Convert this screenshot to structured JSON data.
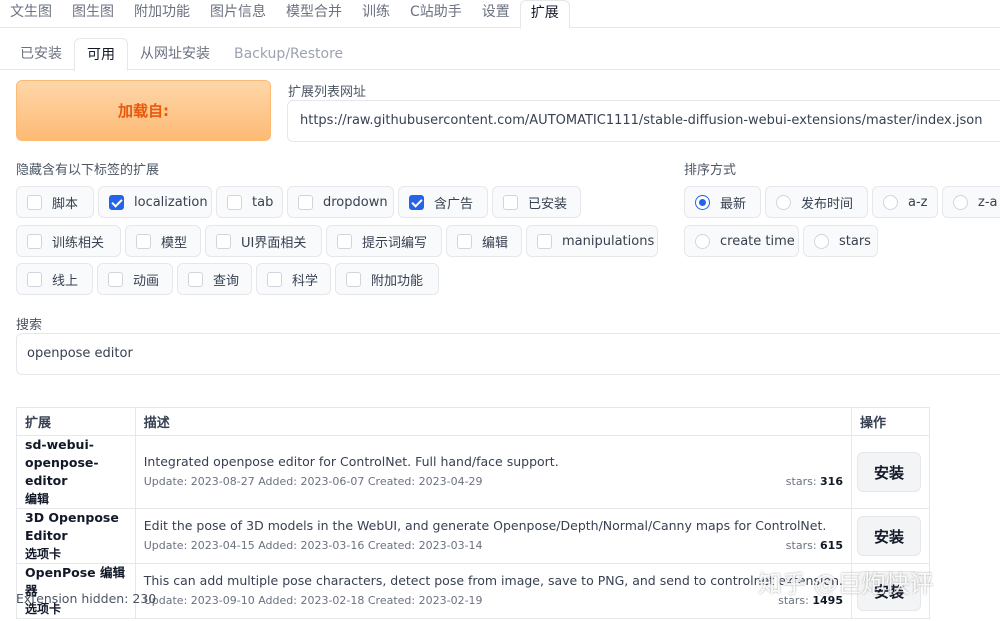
{
  "top_tabs": [
    "文生图",
    "图生图",
    "附加功能",
    "图片信息",
    "模型合并",
    "训练",
    "C站助手",
    "设置",
    "扩展"
  ],
  "sub_tabs": [
    "已安装",
    "可用",
    "从网址安装",
    "Backup/Restore"
  ],
  "load_button": "加载自:",
  "url_label": "扩展列表网址",
  "url_value": "https://raw.githubusercontent.com/AUTOMATIC1111/stable-diffusion-webui-extensions/master/index.json",
  "hide_tags_label": "隐藏含有以下标签的扩展",
  "tags": [
    {
      "label": "脚本",
      "checked": false
    },
    {
      "label": "localization",
      "checked": true
    },
    {
      "label": "tab",
      "checked": false
    },
    {
      "label": "dropdown",
      "checked": false
    },
    {
      "label": "含广告",
      "checked": true
    },
    {
      "label": "已安装",
      "checked": false
    },
    {
      "label": "训练相关",
      "checked": false
    },
    {
      "label": "模型",
      "checked": false
    },
    {
      "label": "UI界面相关",
      "checked": false
    },
    {
      "label": "提示词编写",
      "checked": false
    },
    {
      "label": "编辑",
      "checked": false
    },
    {
      "label": "manipulations",
      "checked": false
    },
    {
      "label": "线上",
      "checked": false
    },
    {
      "label": "动画",
      "checked": false
    },
    {
      "label": "查询",
      "checked": false
    },
    {
      "label": "科学",
      "checked": false
    },
    {
      "label": "附加功能",
      "checked": false
    }
  ],
  "sort_label": "排序方式",
  "sort_options": [
    {
      "label": "最新",
      "selected": true
    },
    {
      "label": "发布时间",
      "selected": false
    },
    {
      "label": "a-z",
      "selected": false
    },
    {
      "label": "z-a",
      "selected": false
    },
    {
      "label": "create time",
      "selected": false
    },
    {
      "label": "stars",
      "selected": false
    }
  ],
  "search_label": "搜索",
  "search_value": "openpose editor",
  "table": {
    "headers": [
      "扩展",
      "描述",
      "操作"
    ],
    "rows": [
      {
        "name": "sd-webui-openpose-editor",
        "tag": "编辑",
        "description": "Integrated openpose editor for ControlNet. Full hand/face support.",
        "dates": "Update: 2023-08-27 Added: 2023-06-07 Created: 2023-04-29",
        "stars_label": "stars:",
        "stars": "316",
        "action": "安装"
      },
      {
        "name": "3D Openpose Editor",
        "tag": "选项卡",
        "description": "Edit the pose of 3D models in the WebUI, and generate Openpose/Depth/Normal/Canny maps for ControlNet.",
        "dates": "Update: 2023-04-15 Added: 2023-03-16 Created: 2023-03-14",
        "stars_label": "stars:",
        "stars": "615",
        "action": "安装"
      },
      {
        "name": "OpenPose 编辑器",
        "tag": "选项卡",
        "description": "This can add multiple pose characters, detect pose from image, save to PNG, and send to controlnet extension.",
        "dates": "Update: 2023-09-10 Added: 2023-02-18 Created: 2023-02-19",
        "stars_label": "stars:",
        "stars": "1495",
        "action": "安装"
      }
    ]
  },
  "hidden_note": "Extension hidden: 230",
  "watermark": "知乎 @巨炮快评"
}
